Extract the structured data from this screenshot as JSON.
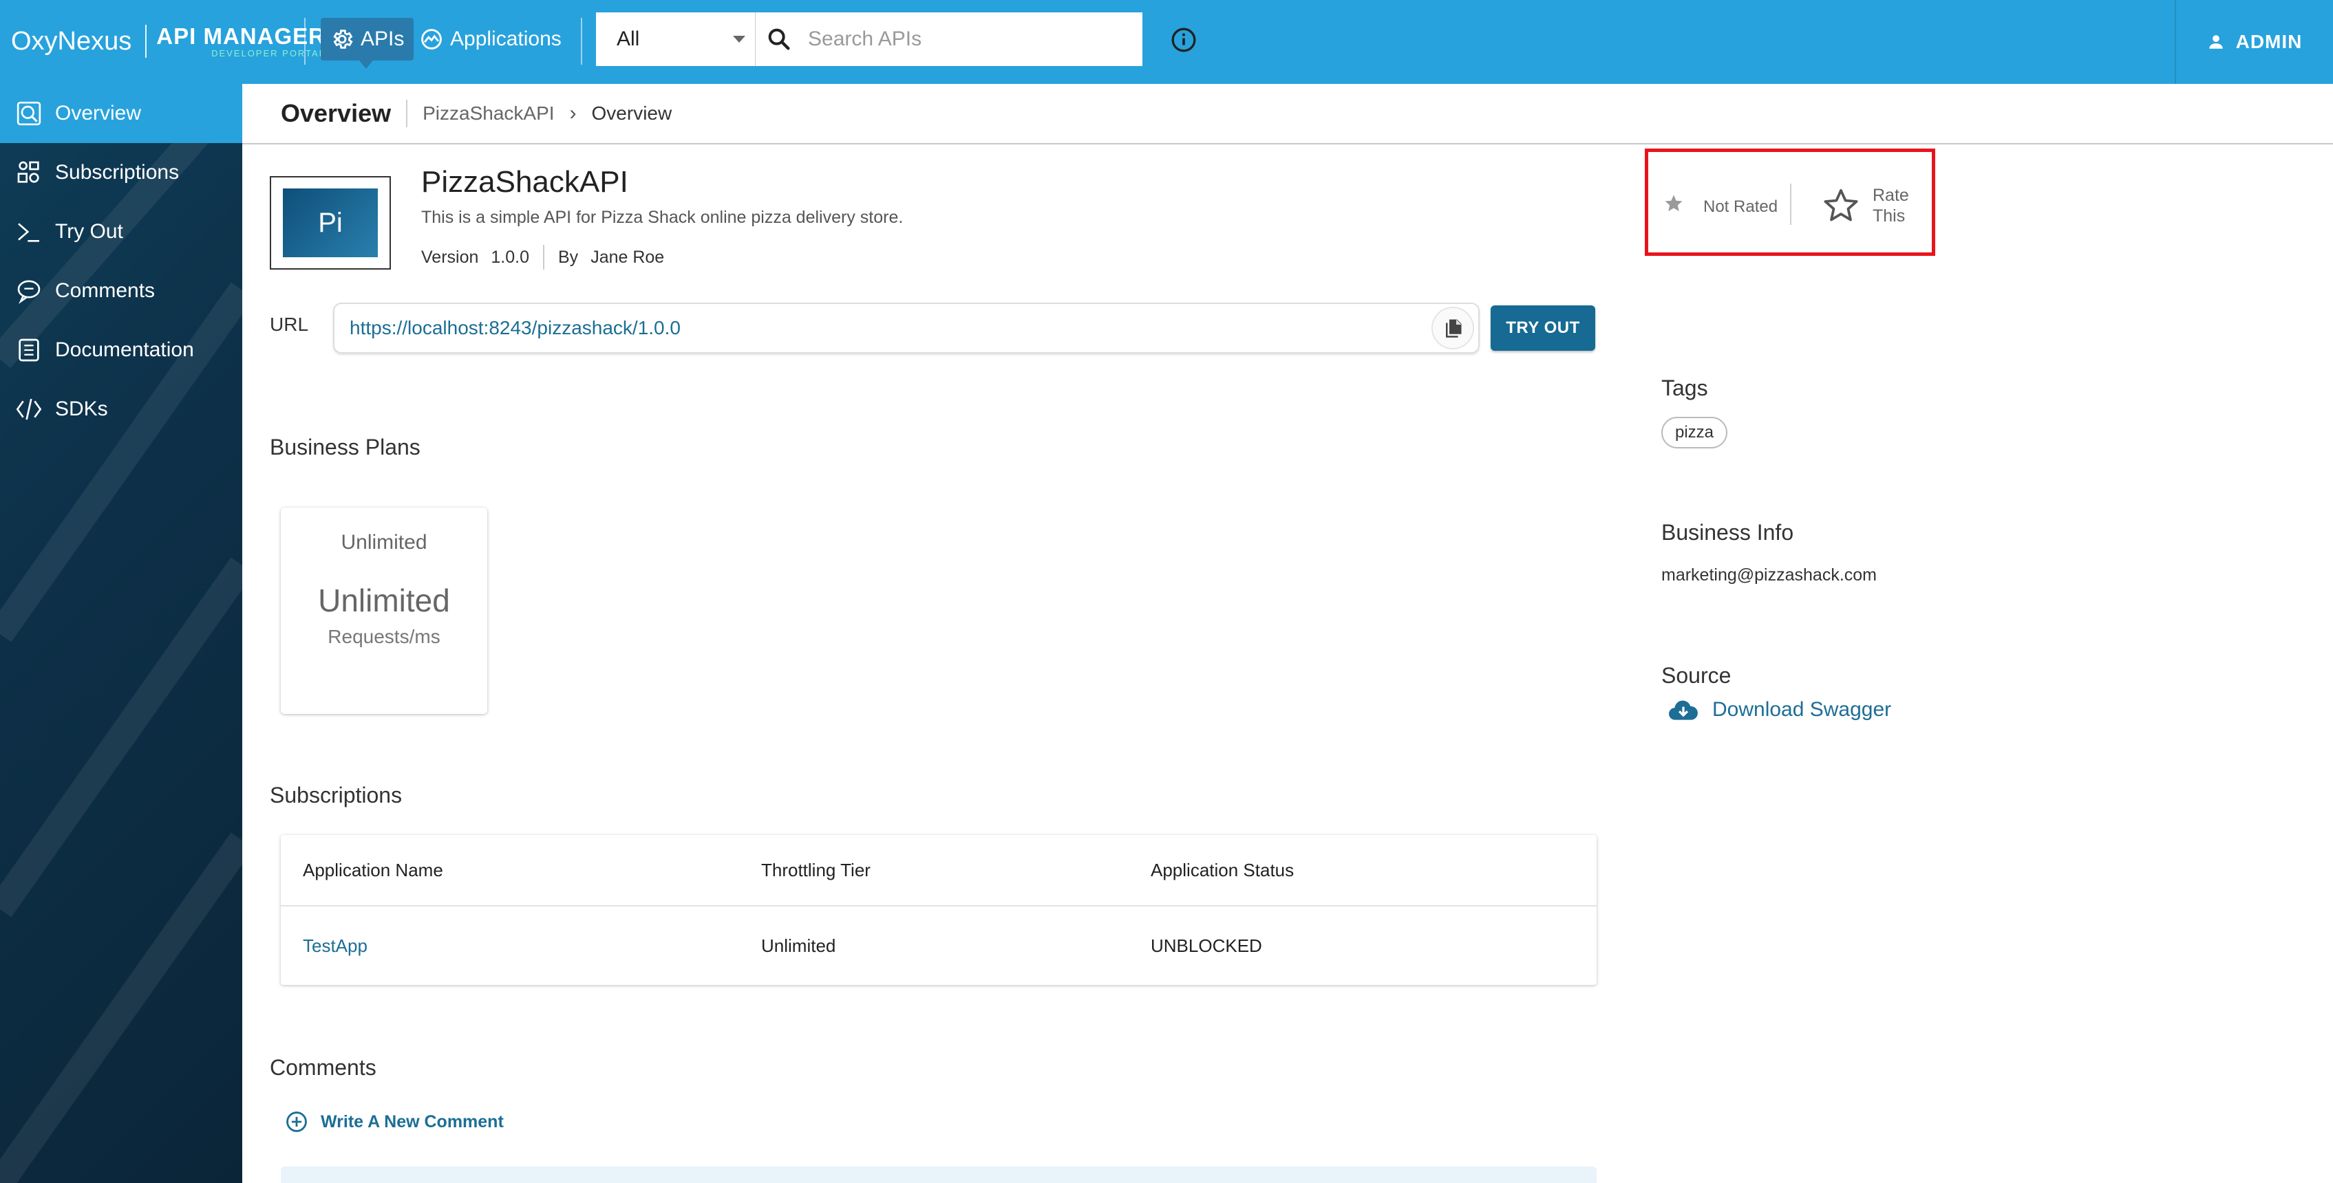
{
  "topbar": {
    "brand_name": "OxyNexus",
    "product_title": "API MANAGER",
    "product_subtitle": "DEVELOPER PORTAL",
    "nav": [
      {
        "label": "APIs",
        "icon": "gear-icon"
      },
      {
        "label": "Applications",
        "icon": "applications-icon"
      }
    ],
    "search": {
      "scope_selected": "All",
      "placeholder": "Search APIs"
    },
    "user": "ADMIN",
    "colors": {
      "bar": "#27a2dd",
      "active_nav": "#2a7bac"
    }
  },
  "sidebar": {
    "items": [
      {
        "label": "Overview",
        "icon": "overview-icon",
        "active": true
      },
      {
        "label": "Subscriptions",
        "icon": "subscriptions-icon"
      },
      {
        "label": "Try Out",
        "icon": "terminal-icon"
      },
      {
        "label": "Comments",
        "icon": "comments-icon"
      },
      {
        "label": "Documentation",
        "icon": "documentation-icon"
      },
      {
        "label": "SDKs",
        "icon": "code-icon"
      }
    ]
  },
  "breadcrumb": {
    "title": "Overview",
    "api": "PizzaShackAPI",
    "current": "Overview"
  },
  "api": {
    "thumb_text": "Pi",
    "name": "PizzaShackAPI",
    "description": "This is a simple API for Pizza Shack online pizza delivery store.",
    "version_label": "Version",
    "version": "1.0.0",
    "by_label": "By",
    "author": "Jane Roe",
    "url_label": "URL",
    "url": "https://localhost:8243/pizzashack/1.0.0",
    "try_out_label": "TRY OUT"
  },
  "business_plans": {
    "heading": "Business Plans",
    "plans": [
      {
        "name": "Unlimited",
        "quota": "Unlimited",
        "unit": "Requests/ms"
      }
    ]
  },
  "subscriptions": {
    "heading": "Subscriptions",
    "columns": [
      "Application Name",
      "Throttling Tier",
      "Application Status"
    ],
    "rows": [
      {
        "app": "TestApp",
        "tier": "Unlimited",
        "status": "UNBLOCKED"
      }
    ]
  },
  "comments": {
    "heading": "Comments",
    "write_label": "Write A New Comment"
  },
  "rating": {
    "status": "Not Rated",
    "rate_label": "Rate This"
  },
  "tags": {
    "heading": "Tags",
    "items": [
      "pizza"
    ]
  },
  "business_info": {
    "heading": "Business Info",
    "email": "marketing@pizzashack.com"
  },
  "source": {
    "heading": "Source",
    "download_label": "Download Swagger"
  }
}
